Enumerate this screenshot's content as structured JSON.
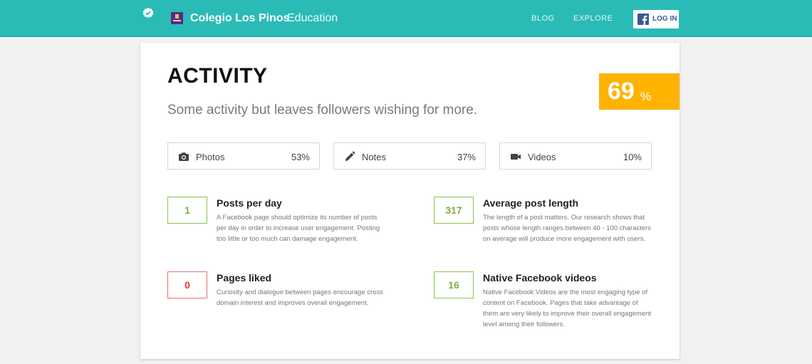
{
  "header": {
    "brand_name": "Colegio Los Pinos",
    "brand_sub": "Education",
    "nav": [
      {
        "label": "BLOG"
      },
      {
        "label": "EXPLORE"
      }
    ],
    "login_label": "LOG IN",
    "colors": {
      "bar": "#2bbbb7",
      "facebook": "#3b5998"
    }
  },
  "activity": {
    "title": "ACTIVITY",
    "subtitle": "Some activity but leaves followers wishing for more.",
    "score": "69",
    "score_unit": "%",
    "score_color": "#ffb300",
    "content_types": [
      {
        "label": "Photos",
        "percent": "53%",
        "icon": "camera-icon"
      },
      {
        "label": "Notes",
        "percent": "37%",
        "icon": "pencil-icon"
      },
      {
        "label": "Videos",
        "percent": "10%",
        "icon": "video-camera-icon"
      }
    ],
    "metrics": [
      {
        "value": "1",
        "title": "Posts per day",
        "description": "A Facebook page should optimize its number of posts per day in order to increase user engagement. Posting too little or too much can damage engagement.",
        "status": "good"
      },
      {
        "value": "317",
        "title": "Average post length",
        "description": "The length of a post matters. Our research shows that posts whose length ranges between 40 - 100 characters on average will produce more engagement with users.",
        "status": "good"
      },
      {
        "value": "0",
        "title": "Pages liked",
        "description": "Curiosity and dialogue between pages encourage cross domain interest and improves overall engagement.",
        "status": "bad"
      },
      {
        "value": "16",
        "title": "Native Facebook videos",
        "description": "Native Facebook Videos are the most engaging type of content on Facebook. Pages that take advantage of them are very likely to improve their overall engagement level among their followers.",
        "status": "good"
      }
    ],
    "status_colors": {
      "good": "#8bc34a",
      "bad": "#e57373"
    }
  }
}
